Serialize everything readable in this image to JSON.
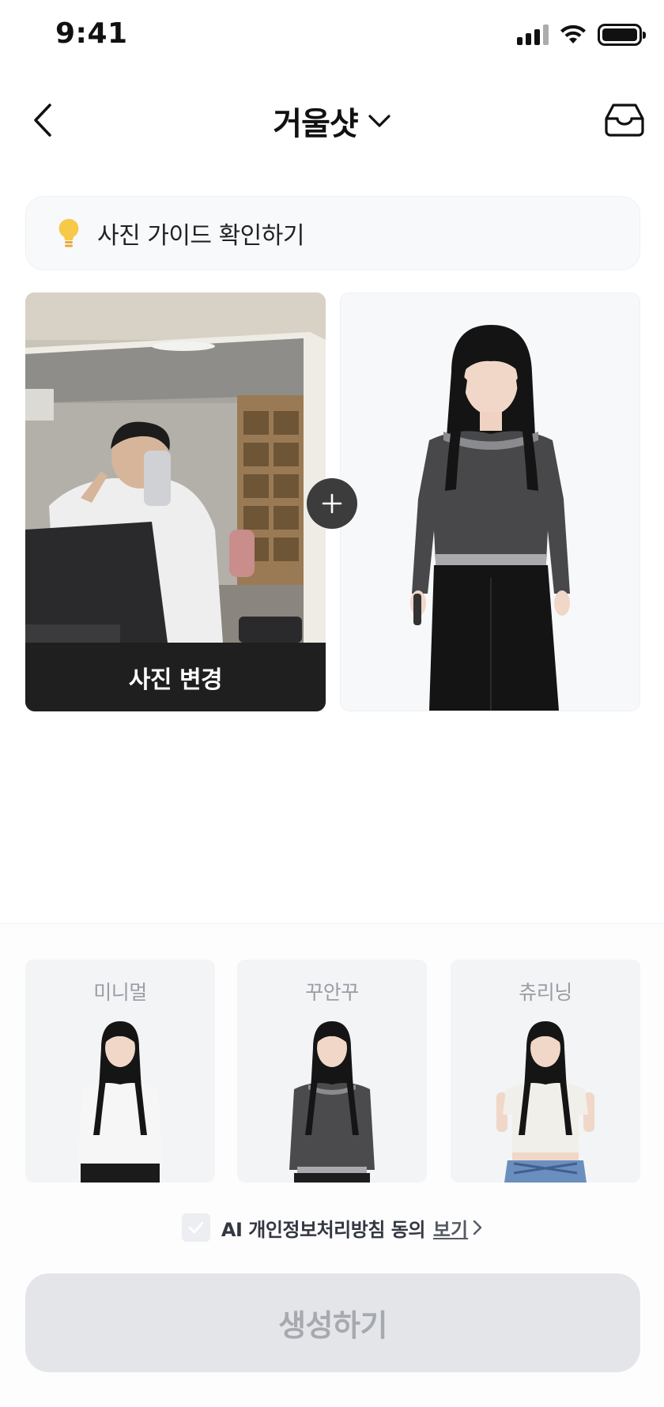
{
  "status_bar": {
    "time": "9:41"
  },
  "nav": {
    "title": "거울샷"
  },
  "guide": {
    "label": "사진 가이드 확인하기"
  },
  "photos": {
    "change_label": "사진 변경"
  },
  "styles": [
    {
      "label": "미니멀",
      "top_color": "#f6f6f6",
      "bottom_color": "#1b1b1b"
    },
    {
      "label": "꾸안꾸",
      "top_color": "#4b4b4e",
      "bottom_color": "#1d1d1d"
    },
    {
      "label": "츄리닝",
      "top_color": "#f1efea",
      "bottom_color": "#6a8fbf"
    }
  ],
  "consent": {
    "text": "AI 개인정보처리방침 동의",
    "link_label": "보기"
  },
  "generate": {
    "label": "생성하기"
  },
  "colors": {
    "accent_dark": "#1f1f1f",
    "disabled_bg": "#e4e5e8",
    "disabled_text": "#a6a9b0",
    "bulb": "#f7c948"
  }
}
